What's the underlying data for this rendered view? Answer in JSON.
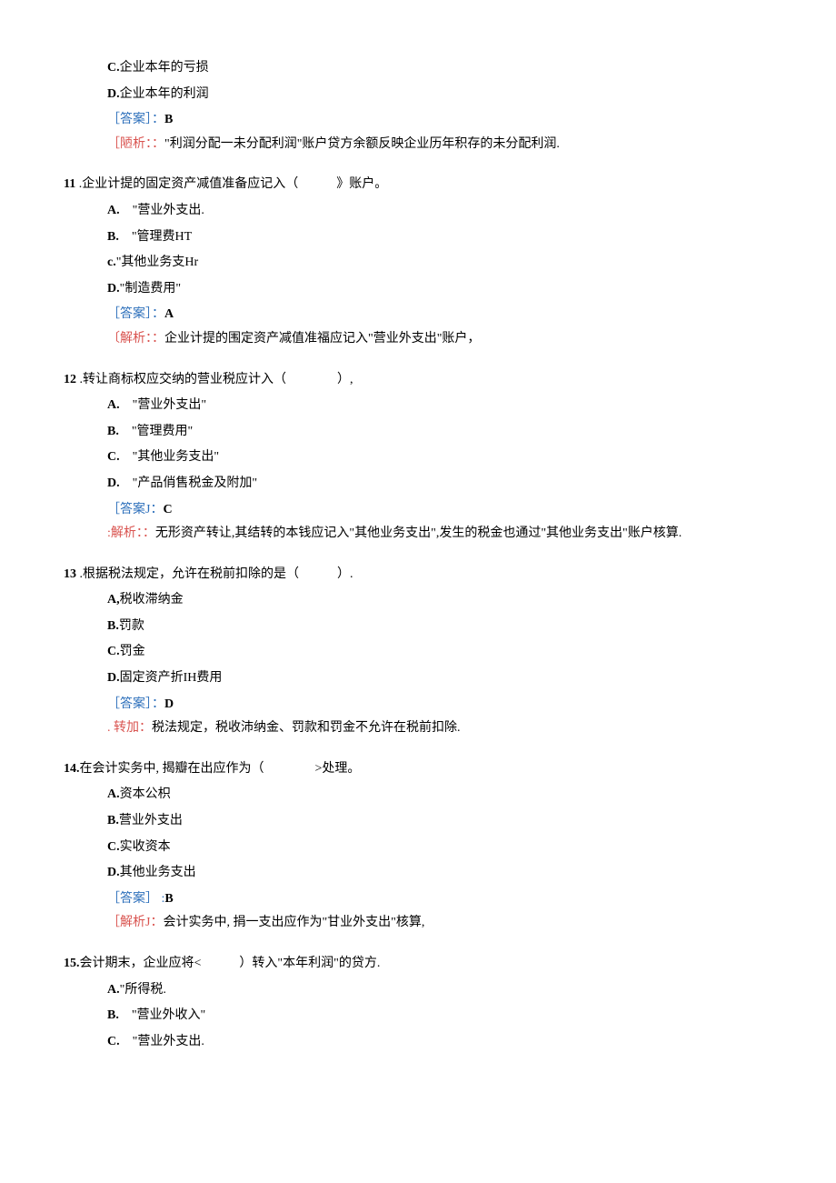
{
  "prefix": {
    "opt_c": {
      "label": "C.",
      "text": "企业本年的亏损"
    },
    "opt_d": {
      "label": "D.",
      "text": "企业本年的利润"
    },
    "answer_label": "［答案］：",
    "answer_value": "B",
    "analysis_label": "［陋析：：",
    "analysis_text": "\"利润分配一未分配利润\"账户贷方余额反映企业历年积存的未分配利润."
  },
  "q11": {
    "num": "11",
    "stem": " .企业计提的固定资产减值准备应记入（　　　》账户。",
    "a": {
      "label": "A.",
      "text": "　\"营业外支出."
    },
    "b": {
      "label": "B.",
      "text": "　\"管理费HT"
    },
    "c": {
      "label": "c.",
      "text": "\"其他业务支Hr"
    },
    "d": {
      "label": "D.",
      "text": "\"制造费用\""
    },
    "answer_label": "［答案］：",
    "answer_value": "A",
    "analysis_label": "〔解析：：",
    "analysis_text": "企业计提的围定资产减值准福应记入\"营业外支出\"账户，"
  },
  "q12": {
    "num": "12",
    "stem": " .转让商标权应交纳的营业税应计入（　　　　）,",
    "a": {
      "label": "A.",
      "text": "　\"营业外支出\""
    },
    "b": {
      "label": "B.",
      "text": "　\"管理费用\""
    },
    "c": {
      "label": "C.",
      "text": "　\"其他业务支出\""
    },
    "d": {
      "label": "D.",
      "text": "　\"产品俏售税金及附加\""
    },
    "answer_label": "［答案J：",
    "answer_value": "C",
    "analysis_label": ":解析：：",
    "analysis_text": "无形资产转让,其结转的本钱应记入\"其他业务支出\",发生的税金也通过\"其他业务支出\"账户核算."
  },
  "q13": {
    "num": "13",
    "stem": " .根据税法规定，允许在税前扣除的是（　　　）.",
    "a": {
      "label": "A,",
      "text": "税收滞纳金"
    },
    "b": {
      "label": "B.",
      "text": "罚款"
    },
    "c": {
      "label": "C.",
      "text": "罚金"
    },
    "d": {
      "label": "D.",
      "text": "固定资产折IH费用"
    },
    "answer_label": "［答案］：",
    "answer_value": "D",
    "analysis_label": ". 转加：",
    "analysis_text": "税法规定，税收沛纳金、罚款和罚金不允许在税前扣除."
  },
  "q14": {
    "num": "14.",
    "stem": "在会计实务中, 揭瓣在出应作为（　　　　>处理。",
    "a": {
      "label": "A.",
      "text": "资本公枳"
    },
    "b": {
      "label": "B.",
      "text": "营业外支出"
    },
    "c": {
      "label": "C.",
      "text": "实收资本"
    },
    "d": {
      "label": "D.",
      "text": "其他业务支出"
    },
    "answer_label": "［答案］ :",
    "answer_value": "B",
    "analysis_label": "［解析J：",
    "analysis_text": "会计实务中, 捐一支出应作为\"甘业外支出\"核算,"
  },
  "q15": {
    "num": "15.",
    "stem": "会计期末，企业应将<　　　）转入\"本年利润\"的贷方.",
    "a": {
      "label": "A.",
      "text": "\"所得税."
    },
    "b": {
      "label": "B.",
      "text": "　\"营业外收入\""
    },
    "c": {
      "label": "C.",
      "text": "　\"营业外支出."
    }
  }
}
